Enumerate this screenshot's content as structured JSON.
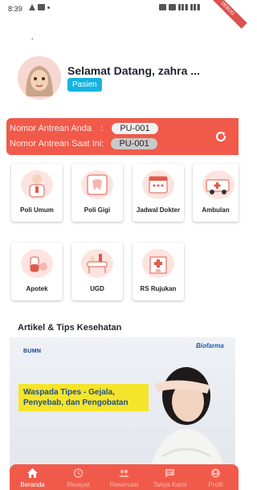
{
  "status_bar": {
    "time": "8:39",
    "debug_badge": "DEBUG"
  },
  "back_mark": "ˏ",
  "profile": {
    "greeting": "Selamat Datang, zahra ...",
    "role": "Pasien"
  },
  "queue": {
    "your_label": "Nomor Antrean Anda",
    "your_sep": ":",
    "your_number": "PU-001",
    "current_label": "Nomor Antrean Saat Ini:",
    "current_number": "PU-001"
  },
  "menu": [
    {
      "label": "Poli Umum",
      "icon": "doctor-illustration"
    },
    {
      "label": "Poli Gigi",
      "icon": "dentist-illustration"
    },
    {
      "label": "Jadwal Dokter",
      "icon": "schedule-illustration"
    },
    {
      "label": "Ambulan",
      "icon": "ambulance-illustration"
    },
    {
      "label": "Apotek",
      "icon": "pharmacy-illustration"
    },
    {
      "label": "UGD",
      "icon": "emergency-illustration"
    },
    {
      "label": "RS Rujukan",
      "icon": "referral-hospital-illustration"
    }
  ],
  "articles": {
    "section_title": "Artikel & Tips Kesehatan",
    "banner": {
      "brand_left": "BUMN",
      "brand_right": "Biofarma",
      "headline": "Waspada Tipes - Gejala, Penyebab, dan Pengobatan"
    }
  },
  "bottom_nav": [
    {
      "label": "Beranda",
      "icon": "home-icon",
      "active": true
    },
    {
      "label": "Riwayat",
      "icon": "history-icon",
      "active": false
    },
    {
      "label": "Reservasi",
      "icon": "people-icon",
      "active": false
    },
    {
      "label": "Tanya Kami",
      "icon": "chat-icon",
      "active": false
    },
    {
      "label": "Profil",
      "icon": "profile-icon",
      "active": false
    }
  ],
  "colors": {
    "primary": "#f15a4a",
    "badge": "#16b3e0",
    "banner_highlight": "#f5e52a"
  }
}
